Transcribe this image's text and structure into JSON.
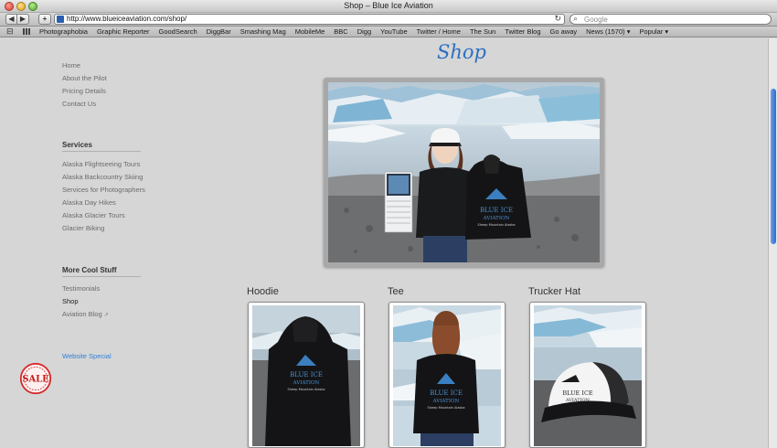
{
  "window": {
    "title": "Shop – Blue Ice Aviation"
  },
  "toolbar": {
    "url": "http://www.blueiceaviation.com/shop/",
    "search_placeholder": "Google"
  },
  "bookmarks": [
    "Photographobia",
    "Graphic Reporter",
    "GoodSearch",
    "DiggBar",
    "Smashing Mag",
    "MobileMe",
    "BBC",
    "Digg",
    "YouTube",
    "Twitter / Home",
    "The Sun",
    "Twitter Blog",
    "Go away",
    "News (1570) ▾",
    "Popular ▾"
  ],
  "page": {
    "title": "Shop"
  },
  "sidebar": {
    "main_links": [
      "Home",
      "About the Pilot",
      "Pricing Details",
      "Contact Us"
    ],
    "services_heading": "Services",
    "services_links": [
      "Alaska Flightseeing Tours",
      "Alaska Backcountry Skiing",
      "Services for Photographers",
      "Alaska Day Hikes",
      "Alaska Glacier Tours",
      "Glacier Biking"
    ],
    "more_heading": "More Cool Stuff",
    "more_links": [
      "Testimonials",
      "Shop",
      "Aviation Blog"
    ],
    "special_label": "Website Special",
    "sale_badge": "SALE"
  },
  "products": [
    {
      "name": "Hoodie"
    },
    {
      "name": "Tee"
    },
    {
      "name": "Trucker Hat"
    }
  ],
  "garment_print": {
    "brand": "BLUE ICE",
    "line2": "AVIATION",
    "tagline": "Sheep Mountain Alaska"
  }
}
